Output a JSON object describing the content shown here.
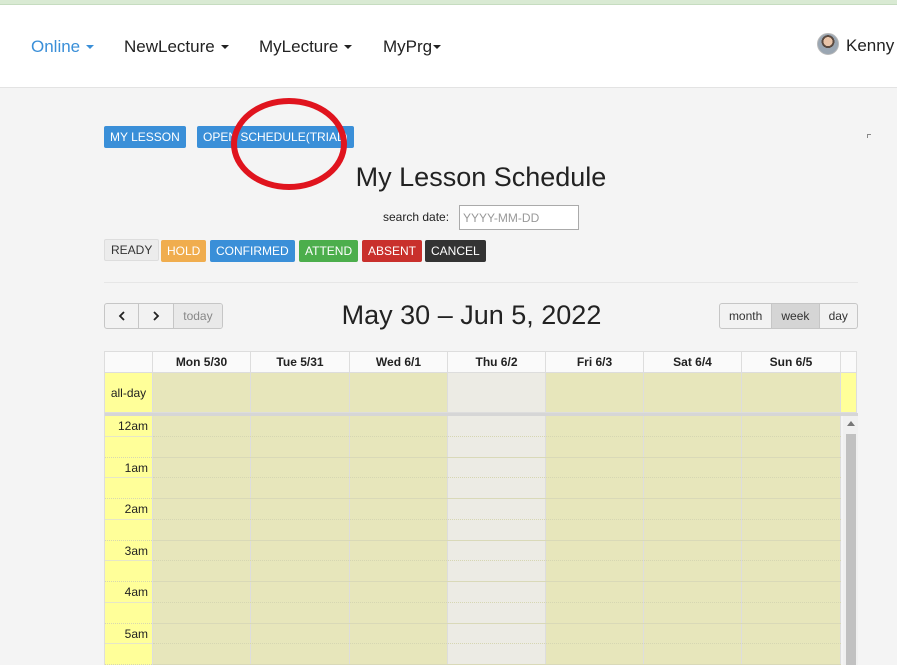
{
  "nav": {
    "items": [
      {
        "label": "Online",
        "active": true
      },
      {
        "label": "NewLecture"
      },
      {
        "label": "MyLecture"
      },
      {
        "label": "MyPrg"
      }
    ],
    "user": "Kenny"
  },
  "top_buttons": {
    "my_lesson": "MY LESSON",
    "open_schedule": "OPEN SCHEDULE(TRIAL)"
  },
  "page_title": "My Lesson Schedule",
  "search": {
    "label": "search date:",
    "placeholder": "YYYY-MM-DD",
    "value": ""
  },
  "statuses": [
    {
      "label": "READY",
      "color": "#ececec"
    },
    {
      "label": "HOLD",
      "color": "#f0ad4e"
    },
    {
      "label": "CONFIRMED",
      "color": "#3a8fd8"
    },
    {
      "label": "ATTEND",
      "color": "#4cae4c"
    },
    {
      "label": "ABSENT",
      "color": "#c9302c"
    },
    {
      "label": "CANCEL",
      "color": "#333333"
    }
  ],
  "calendar": {
    "today_label": "today",
    "title": "May 30 – Jun 5, 2022",
    "views": {
      "month": "month",
      "week": "week",
      "day": "day"
    },
    "active_view": "week",
    "days": [
      "Mon 5/30",
      "Tue 5/31",
      "Wed 6/1",
      "Thu 6/2",
      "Fri 6/3",
      "Sat 6/4",
      "Sun 6/5"
    ],
    "today_day": "Thu 6/2",
    "all_day_label": "all-day",
    "times": [
      "12am",
      "1am",
      "2am",
      "3am",
      "4am",
      "5am"
    ]
  },
  "colors": {
    "accent": "#3a8fd8",
    "annotation": "#e0141e",
    "slot": "#e7e6bb",
    "today_slot": "#ecebe4",
    "label_col": "#ffff99"
  }
}
